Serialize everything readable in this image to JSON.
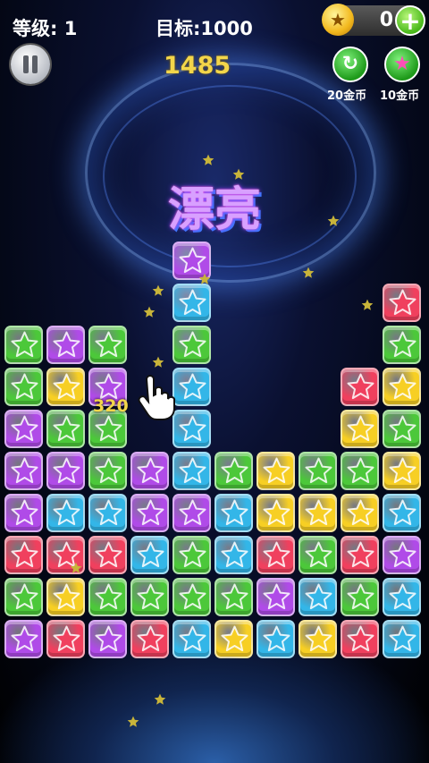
{
  "hud": {
    "level_label": "等级: 1",
    "target_label": "目标:1000",
    "score": "1485",
    "coins": "0"
  },
  "icons": {
    "coin": "coin-icon",
    "add": "plus-icon",
    "pause": "pause-icon",
    "refresh": "refresh-icon",
    "magic": "magic-star-icon",
    "hand": "pointer-hand-icon"
  },
  "powerups": {
    "refresh_cost": "20金币",
    "magic_cost": "10金币"
  },
  "banner": "漂亮",
  "combo_score": "320",
  "colors": {
    "G": "#4cc83a",
    "P": "#b04be8",
    "Y": "#f7cf24",
    "B": "#33b6e8",
    "R": "#f0405e"
  },
  "board": {
    "columns": 10,
    "rows": 11,
    "grid": [
      "....P.....",
      "....B....R",
      "GPG.G....G",
      "GYP.B...RY",
      "PGG.B...YG",
      "PPGPBGYGGY",
      "PBBPPBYYYB",
      "RRRBGBRGRP",
      "GYGGGGPBGB",
      "PRPRBYBYRB",
      ".........."
    ]
  }
}
